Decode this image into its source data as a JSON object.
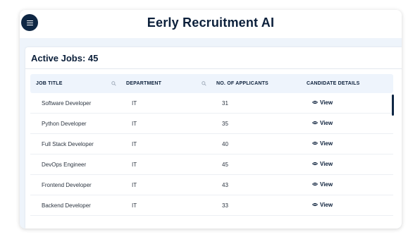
{
  "header": {
    "title": "Eerly Recruitment AI"
  },
  "panel": {
    "title": "Active Jobs: 45"
  },
  "table": {
    "columns": [
      "JOB TITLE",
      "DEPARTMENT",
      "NO. OF APPLICANTS",
      "CANDIDATE DETAILS"
    ],
    "rows": [
      {
        "title": "Software Developer",
        "department": "IT",
        "applicants": "31",
        "action": "View"
      },
      {
        "title": "Python Developer",
        "department": "IT",
        "applicants": "35",
        "action": "View"
      },
      {
        "title": "Full Stack Developer",
        "department": "IT",
        "applicants": "40",
        "action": "View"
      },
      {
        "title": "DevOps Engineer",
        "department": "IT",
        "applicants": "45",
        "action": "View"
      },
      {
        "title": "Frontend Developer",
        "department": "IT",
        "applicants": "43",
        "action": "View"
      },
      {
        "title": "Backend Developer",
        "department": "IT",
        "applicants": "33",
        "action": "View"
      }
    ]
  },
  "icons": {
    "menu": "hamburger-icon",
    "column_search": "search-icon",
    "view": "eye-icon"
  },
  "colors": {
    "brand_dark": "#0f2744",
    "header_row_bg": "#eef4fc",
    "content_bg": "#eef4fb"
  }
}
